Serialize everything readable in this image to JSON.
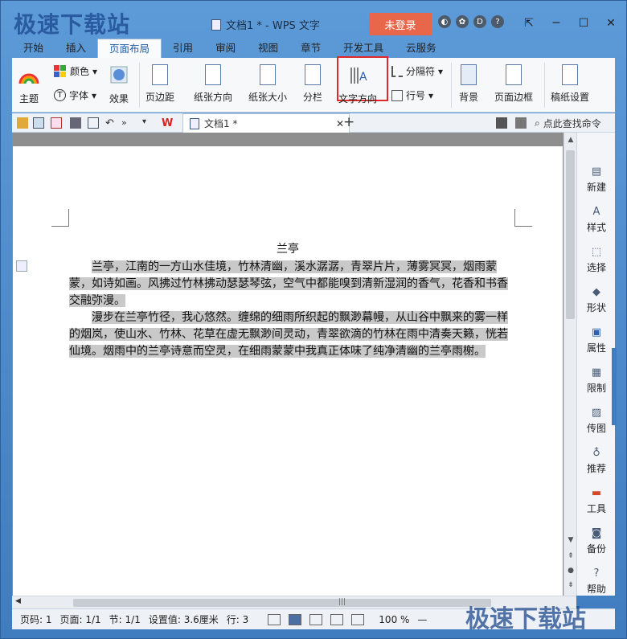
{
  "window": {
    "app_name": "WPS 文字",
    "title": "文档1 * - WPS 文字",
    "login_label": "未登录",
    "controls": [
      "─",
      "☐",
      "✕"
    ]
  },
  "watermark": {
    "top_left": "极速下载站",
    "bottom_right": "极速下载站"
  },
  "menu": {
    "tabs": [
      "开始",
      "插入",
      "页面布局",
      "引用",
      "审阅",
      "视图",
      "章节",
      "开发工具",
      "云服务"
    ],
    "active_tab": "页面布局"
  },
  "ribbon": {
    "theme": "主题",
    "color": "颜色",
    "font": "字体",
    "effect": "效果",
    "margins": "页边距",
    "orientation": "纸张方向",
    "size": "纸张大小",
    "columns": "分栏",
    "text_direction": "文字方向",
    "breaks": "分隔符",
    "line_numbers": "行号",
    "background": "背景",
    "page_border": "页面边框",
    "manuscript": "稿纸设置"
  },
  "quick_toolbar": {
    "doc_tab_label": "文档1 *",
    "search_label": "点此查找命令",
    "new_tab": "+"
  },
  "document": {
    "title": "兰亭",
    "paragraph1": "兰亭，江南的一方山水佳境，竹林清幽，溪水潺潺，青翠片片，薄雾冥冥，烟雨蒙蒙，如诗如画。风拂过竹林拂动瑟瑟琴弦，空气中都能嗅到清新湿润的香气，花香和书香交融弥漫。",
    "paragraph2": "漫步在兰亭竹径，我心悠然。缠绵的细雨所织起的飘渺幕幔，从山谷中飘来的雾一样的烟岚，使山水、竹林、花草在虚无飘渺间灵动，青翠欲滴的竹林在雨中清奏天籁，恍若仙境。烟雨中的兰亭诗意而空灵，在细雨蒙蒙中我真正体味了纯净清幽的兰亭雨榭。"
  },
  "right_panel": {
    "items": [
      "新建",
      "样式",
      "选择",
      "形状",
      "属性",
      "限制",
      "传图",
      "推荐",
      "工具",
      "备份",
      "帮助"
    ]
  },
  "status": {
    "page_code": "页码: 1",
    "pages": "页面: 1/1",
    "section": "节: 1/1",
    "setting": "设置值: 3.6厘米",
    "line": "行: 3",
    "zoom": "100 %"
  },
  "colors": {
    "accent": "#1f5ea8",
    "login": "#e8674a",
    "highlight_box": "#e02a2a",
    "selection": "#c9c9c9"
  }
}
